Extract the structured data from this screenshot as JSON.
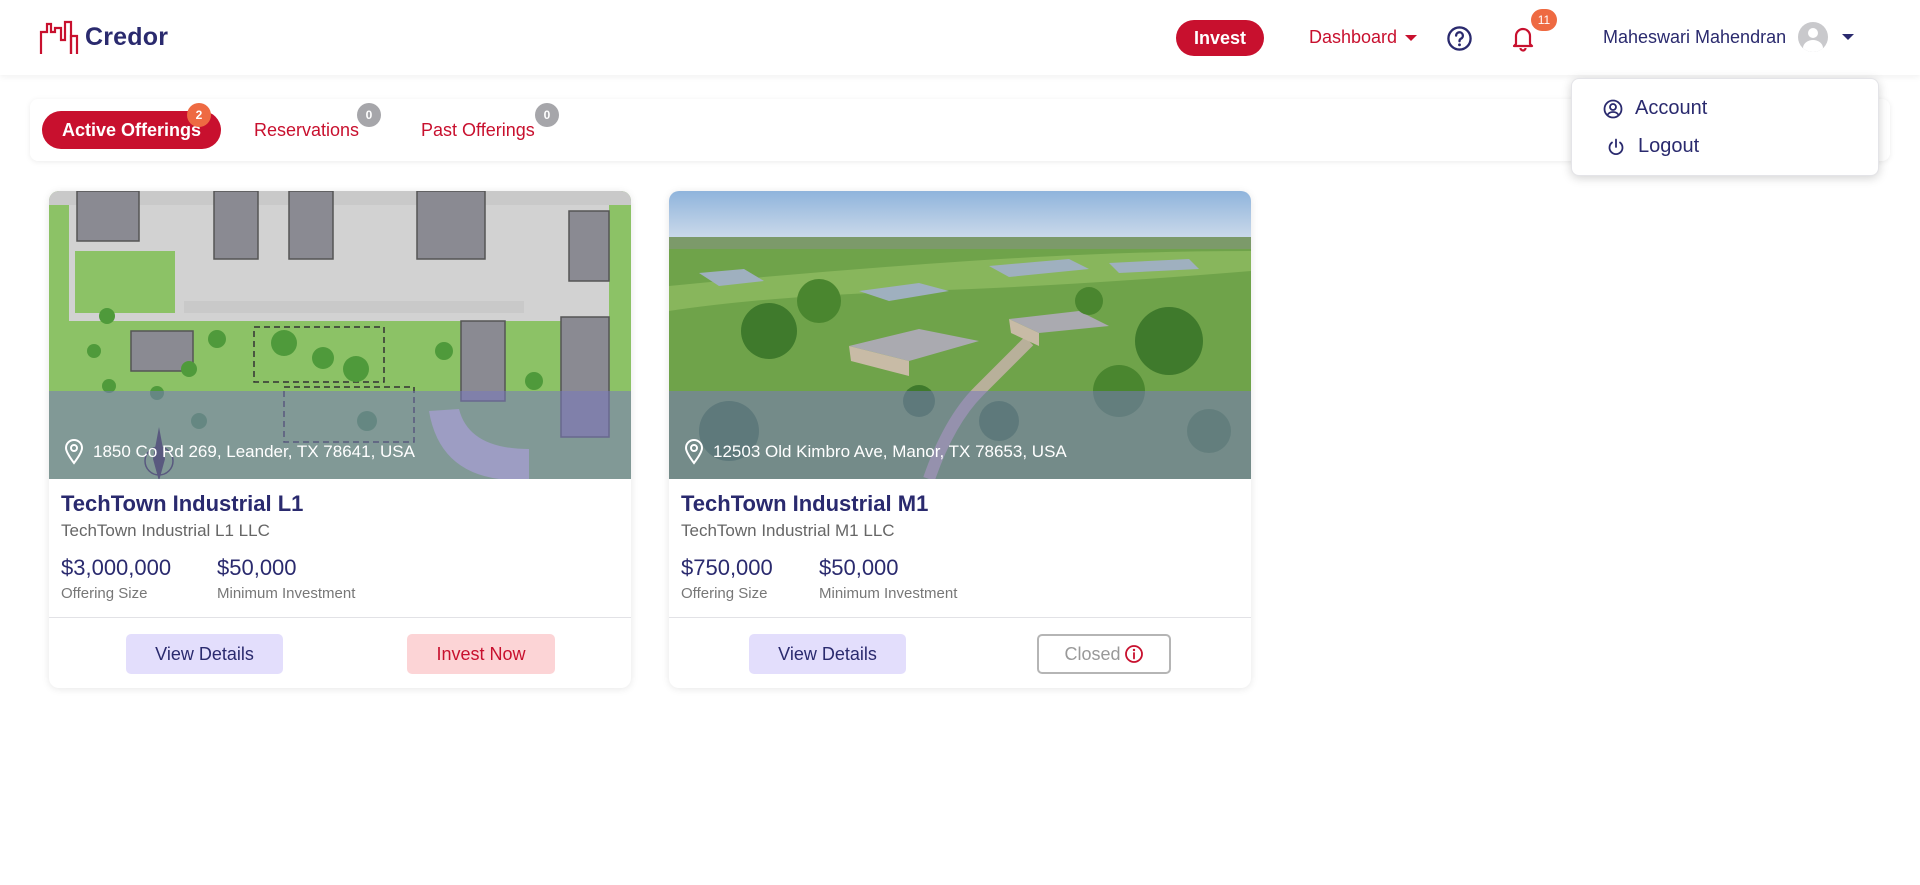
{
  "header": {
    "logo_text": "Credor",
    "invest_label": "Invest",
    "dashboard_label": "Dashboard",
    "notification_count": "11",
    "user_name": "Maheswari Mahendran"
  },
  "user_menu": {
    "items": [
      {
        "label": "Account",
        "icon": "user-circle-icon"
      },
      {
        "label": "Logout",
        "icon": "power-icon"
      }
    ]
  },
  "tabs": [
    {
      "label": "Active Offerings",
      "count": "2",
      "active": true
    },
    {
      "label": "Reservations",
      "count": "0",
      "active": false
    },
    {
      "label": "Past Offerings",
      "count": "0",
      "active": false
    }
  ],
  "offerings": [
    {
      "address": "1850 Co Rd 269, Leander, TX 78641, USA",
      "title": "TechTown Industrial L1",
      "entity": "TechTown Industrial L1 LLC",
      "offering_size": "$3,000,000",
      "offering_size_label": "Offering Size",
      "min_investment": "$50,000",
      "min_investment_label": "Minimum Investment",
      "primary_button": "View Details",
      "secondary_button": "Invest Now",
      "image": "site-plan-drawing"
    },
    {
      "address": "12503 Old Kimbro Ave, Manor, TX 78653, USA",
      "title": "TechTown Industrial M1",
      "entity": "TechTown Industrial M1 LLC",
      "offering_size": "$750,000",
      "offering_size_label": "Offering Size",
      "min_investment": "$50,000",
      "min_investment_label": "Minimum Investment",
      "primary_button": "View Details",
      "secondary_button": "Closed",
      "image": "aerial-ranch-photo"
    }
  ],
  "colors": {
    "brand_red": "#c8102e",
    "navy": "#2a2a6e",
    "badge_orange": "#ee6a42",
    "view_button_bg": "#e3defc",
    "invest_button_bg": "#fcd4d6"
  }
}
